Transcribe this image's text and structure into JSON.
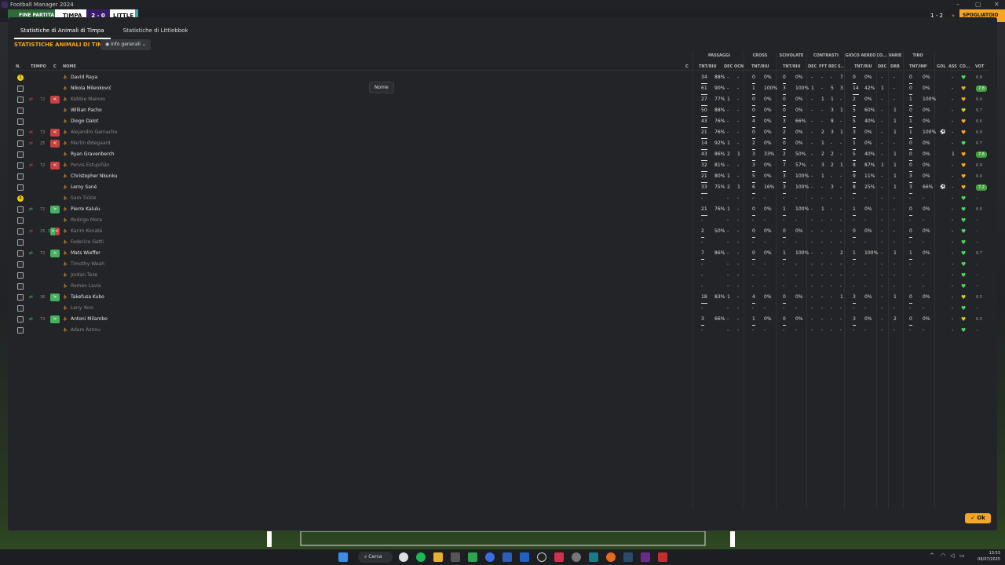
{
  "window": {
    "title": "Football Manager 2024",
    "minimize": "–",
    "maximize": "▢",
    "close": "✕"
  },
  "scorebar": {
    "end_label": "FINE PARTITA",
    "home": "TIMPA",
    "score": "2 - 0",
    "away": "LITTLE",
    "right_score": "1 - 2",
    "right_arrow": "»",
    "right_label": "SPOGLIATOIO"
  },
  "tabs": [
    {
      "label": "Statistiche di Animali di Timpa"
    },
    {
      "label": "Statistiche di Littlebbok"
    }
  ],
  "section_title": "STATISTICHE ANIMALI DI TIMPA",
  "view_dropdown": {
    "label": "Info generali"
  },
  "group_headers": {
    "passaggi": "PASSAGGI",
    "cross": "CROSS",
    "scivolate": "SCIVOLATE",
    "contrasti": "CONTRASTI",
    "gioco_aereo": "GIOCO AEREO",
    "co": "CO...",
    "varie": "VARIE",
    "tiro": "TIRO"
  },
  "col_headers": {
    "n": "N.",
    "tempo": "TEMPO",
    "c": "C",
    "nome": "NOME",
    "c2": "C",
    "pass": "TNT/RIU",
    "pass_dec": "DEC",
    "pass_occ": "OCN",
    "cross": "TNT/RIU",
    "sciv": "TNT/RIU",
    "con_dec": "DEC",
    "con_fft": "FFT",
    "con_rec": "REC",
    "con_s": "S...",
    "aereo": "TNT/RIU",
    "co_dec": "DEC",
    "drb": "DRB",
    "tiro": "TNT/INP",
    "gol": "GOL",
    "ass": "ASS",
    "cond": "CO...",
    "vot": "VOT"
  },
  "tooltip": "Nome",
  "players": [
    {
      "shirt": "gk",
      "no": "1",
      "sub": "",
      "min": "",
      "c": "",
      "name": "David Raya",
      "dim": false,
      "p1": "34",
      "p2": "88%",
      "pd": "-",
      "po": "-",
      "c1": "0",
      "c2": "0%",
      "s1": "0",
      "s2": "0%",
      "k1": "-",
      "k2": "-",
      "k3": "-",
      "k4": "7",
      "a1": "0",
      "a2": "0%",
      "cd": "-",
      "drb": "-",
      "t1": "0",
      "t2": "0%",
      "gol": "",
      "ass": "-",
      "heart": "g",
      "vot": "6.8"
    },
    {
      "shirt": "",
      "no": "",
      "sub": "",
      "min": "",
      "c": "",
      "name": "Nikola Milenković",
      "dim": false,
      "p1": "61",
      "p2": "90%",
      "pd": "-",
      "po": "-",
      "c1": "1",
      "c2": "100%",
      "s1": "3",
      "s2": "100%",
      "k1": "1",
      "k2": "-",
      "k3": "5",
      "k4": "3",
      "a1": "14",
      "a2": "42%",
      "cd": "1",
      "drb": "-",
      "t1": "0",
      "t2": "0%",
      "gol": "",
      "ass": "-",
      "heart": "o",
      "vot": "7.8",
      "hi": true
    },
    {
      "shirt": "",
      "no": "",
      "sub": "out",
      "min": "72",
      "c": "out",
      "name": "Kobbie Mainoo",
      "dim": true,
      "p1": "27",
      "p2": "77%",
      "pd": "1",
      "po": "-",
      "c1": "0",
      "c2": "0%",
      "s1": "0",
      "s2": "0%",
      "k1": "-",
      "k2": "1",
      "k3": "1",
      "k4": "-",
      "a1": "2",
      "a2": "0%",
      "cd": "-",
      "drb": "-",
      "t1": "1",
      "t2": "100%",
      "gol": "",
      "ass": "-",
      "heart": "o",
      "vot": "6.4"
    },
    {
      "shirt": "",
      "no": "",
      "sub": "",
      "min": "",
      "c": "",
      "name": "Willian Pacho",
      "dim": false,
      "p1": "50",
      "p2": "88%",
      "pd": "-",
      "po": "-",
      "c1": "0",
      "c2": "0%",
      "s1": "0",
      "s2": "0%",
      "k1": "-",
      "k2": "-",
      "k3": "3",
      "k4": "1",
      "a1": "5",
      "a2": "60%",
      "cd": "-",
      "drb": "1",
      "t1": "0",
      "t2": "0%",
      "gol": "",
      "ass": "-",
      "heart": "y",
      "vot": "6.7"
    },
    {
      "shirt": "",
      "no": "",
      "sub": "",
      "min": "",
      "c": "",
      "name": "Diogo Dalot",
      "dim": false,
      "p1": "43",
      "p2": "76%",
      "pd": "-",
      "po": "-",
      "c1": "4",
      "c2": "0%",
      "s1": "3",
      "s2": "66%",
      "k1": "-",
      "k2": "-",
      "k3": "8",
      "k4": "-",
      "a1": "5",
      "a2": "40%",
      "cd": "-",
      "drb": "1",
      "t1": "1",
      "t2": "0%",
      "gol": "",
      "ass": "-",
      "heart": "o",
      "vot": "6.6"
    },
    {
      "shirt": "",
      "no": "",
      "sub": "out",
      "min": "73",
      "c": "out",
      "name": "Alejandro Garnacho",
      "dim": true,
      "p1": "21",
      "p2": "76%",
      "pd": "-",
      "po": "-",
      "c1": "0",
      "c2": "0%",
      "s1": "2",
      "s2": "0%",
      "k1": "-",
      "k2": "2",
      "k3": "3",
      "k4": "1",
      "a1": "3",
      "a2": "0%",
      "cd": "-",
      "drb": "1",
      "t1": "1",
      "t2": "100%",
      "gol": "⚽",
      "ass": "-",
      "heart": "o",
      "vot": "6.9"
    },
    {
      "shirt": "",
      "no": "",
      "sub": "out",
      "min": "25",
      "c": "out",
      "name": "Martin Ødegaard",
      "dim": true,
      "p1": "14",
      "p2": "92%",
      "pd": "1",
      "po": "-",
      "c1": "2",
      "c2": "0%",
      "s1": "0",
      "s2": "0%",
      "k1": "-",
      "k2": "1",
      "k3": "-",
      "k4": "-",
      "a1": "1",
      "a2": "0%",
      "cd": "-",
      "drb": "-",
      "t1": "0",
      "t2": "0%",
      "gol": "",
      "ass": "-",
      "heart": "g",
      "vot": "6.7"
    },
    {
      "shirt": "",
      "no": "",
      "sub": "",
      "min": "",
      "c": "",
      "name": "Ryan Gravenberch",
      "dim": false,
      "p1": "43",
      "p2": "86%",
      "pd": "2",
      "po": "1",
      "c1": "3",
      "c2": "33%",
      "s1": "2",
      "s2": "50%",
      "k1": "-",
      "k2": "2",
      "k3": "2",
      "k4": "-",
      "a1": "5",
      "a2": "40%",
      "cd": "-",
      "drb": "1",
      "t1": "0",
      "t2": "0%",
      "gol": "",
      "ass": "1",
      "heart": "o",
      "vot": "7.6",
      "hi": true
    },
    {
      "shirt": "",
      "no": "",
      "sub": "out",
      "min": "72",
      "c": "out",
      "name": "Pervis Estupiñán",
      "dim": true,
      "p1": "32",
      "p2": "81%",
      "pd": "-",
      "po": "-",
      "c1": "3",
      "c2": "0%",
      "s1": "7",
      "s2": "57%",
      "k1": "-",
      "k2": "3",
      "k3": "2",
      "k4": "1",
      "a1": "8",
      "a2": "87%",
      "cd": "1",
      "drb": "1",
      "t1": "0",
      "t2": "0%",
      "gol": "",
      "ass": "-",
      "heart": "o",
      "vot": "6.9"
    },
    {
      "shirt": "",
      "no": "",
      "sub": "",
      "min": "",
      "c": "",
      "name": "Christopher Nkunku",
      "dim": false,
      "p1": "21",
      "p2": "80%",
      "pd": "1",
      "po": "-",
      "c1": "5",
      "c2": "0%",
      "s1": "3",
      "s2": "100%",
      "k1": "-",
      "k2": "1",
      "k3": "-",
      "k4": "-",
      "a1": "9",
      "a2": "11%",
      "cd": "-",
      "drb": "1",
      "t1": "3",
      "t2": "0%",
      "gol": "",
      "ass": "-",
      "heart": "o",
      "vot": "6.4"
    },
    {
      "shirt": "",
      "no": "",
      "sub": "",
      "min": "",
      "c": "",
      "name": "Leroy Sané",
      "dim": false,
      "p1": "33",
      "p2": "75%",
      "pd": "2",
      "po": "1",
      "c1": "6",
      "c2": "16%",
      "s1": "3",
      "s2": "100%",
      "k1": "-",
      "k2": "-",
      "k3": "3",
      "k4": "-",
      "a1": "8",
      "a2": "25%",
      "cd": "-",
      "drb": "1",
      "t1": "3",
      "t2": "66%",
      "gol": "⚽",
      "ass": "-",
      "heart": "o",
      "vot": "7.2",
      "hi": true
    },
    {
      "shirt": "gk",
      "no": "R",
      "sub": "",
      "min": "",
      "c": "",
      "name": "Sam Tickle",
      "dim": true,
      "p1": "-",
      "p2": "",
      "pd": "-",
      "po": "-",
      "c1": "-",
      "c2": "-",
      "s1": "-",
      "s2": "-",
      "k1": "-",
      "k2": "-",
      "k3": "-",
      "k4": "-",
      "a1": "-",
      "a2": "-",
      "cd": "-",
      "drb": "-",
      "t1": "-",
      "t2": "-",
      "gol": "",
      "ass": "-",
      "heart": "g",
      "vot": "-"
    },
    {
      "shirt": "",
      "no": "",
      "sub": "in",
      "min": "72",
      "c": "in",
      "name": "Pierre Kalulu",
      "dim": false,
      "p1": "21",
      "p2": "76%",
      "pd": "1",
      "po": "-",
      "c1": "0",
      "c2": "0%",
      "s1": "1",
      "s2": "100%",
      "k1": "-",
      "k2": "1",
      "k3": "-",
      "k4": "-",
      "a1": "1",
      "a2": "0%",
      "cd": "-",
      "drb": "-",
      "t1": "0",
      "t2": "0%",
      "gol": "",
      "ass": "-",
      "heart": "g",
      "vot": "6.6"
    },
    {
      "shirt": "",
      "no": "",
      "sub": "",
      "min": "",
      "c": "",
      "name": "Rodrigo Mora",
      "dim": true,
      "p1": "-",
      "p2": "",
      "pd": "-",
      "po": "-",
      "c1": "-",
      "c2": "-",
      "s1": "-",
      "s2": "-",
      "k1": "-",
      "k2": "-",
      "k3": "-",
      "k4": "-",
      "a1": "-",
      "a2": "-",
      "cd": "-",
      "drb": "-",
      "t1": "-",
      "t2": "-",
      "gol": "",
      "ass": "-",
      "heart": "g",
      "vot": "-"
    },
    {
      "shirt": "",
      "no": "",
      "sub": "both",
      "min": "25, 36",
      "c": "both",
      "name": "Karim Konaté",
      "dim": true,
      "p1": "2",
      "p2": "50%",
      "pd": "-",
      "po": "-",
      "c1": "0",
      "c2": "0%",
      "s1": "0",
      "s2": "0%",
      "k1": "-",
      "k2": "-",
      "k3": "-",
      "k4": "-",
      "a1": "0",
      "a2": "0%",
      "cd": "-",
      "drb": "-",
      "t1": "0",
      "t2": "0%",
      "gol": "",
      "ass": "-",
      "heart": "g",
      "vot": "-"
    },
    {
      "shirt": "",
      "no": "",
      "sub": "",
      "min": "",
      "c": "",
      "name": "Federico Gatti",
      "dim": true,
      "p1": "-",
      "p2": "",
      "pd": "-",
      "po": "-",
      "c1": "-",
      "c2": "-",
      "s1": "-",
      "s2": "-",
      "k1": "-",
      "k2": "-",
      "k3": "-",
      "k4": "-",
      "a1": "-",
      "a2": "-",
      "cd": "-",
      "drb": "-",
      "t1": "-",
      "t2": "-",
      "gol": "",
      "ass": "-",
      "heart": "g",
      "vot": "-"
    },
    {
      "shirt": "",
      "no": "",
      "sub": "in",
      "min": "72",
      "c": "in",
      "name": "Mats Wieffer",
      "dim": false,
      "p1": "7",
      "p2": "86%",
      "pd": "-",
      "po": "-",
      "c1": "0",
      "c2": "0%",
      "s1": "1",
      "s2": "100%",
      "k1": "-",
      "k2": "-",
      "k3": "-",
      "k4": "2",
      "a1": "1",
      "a2": "100%",
      "cd": "-",
      "drb": "1",
      "t1": "1",
      "t2": "0%",
      "gol": "",
      "ass": "-",
      "heart": "g",
      "vot": "6.7"
    },
    {
      "shirt": "",
      "no": "",
      "sub": "",
      "min": "",
      "c": "",
      "name": "Timothy Weah",
      "dim": true,
      "p1": "-",
      "p2": "",
      "pd": "-",
      "po": "-",
      "c1": "-",
      "c2": "-",
      "s1": "-",
      "s2": "-",
      "k1": "-",
      "k2": "-",
      "k3": "-",
      "k4": "-",
      "a1": "-",
      "a2": "-",
      "cd": "-",
      "drb": "-",
      "t1": "-",
      "t2": "-",
      "gol": "",
      "ass": "-",
      "heart": "g",
      "vot": "-"
    },
    {
      "shirt": "",
      "no": "",
      "sub": "",
      "min": "",
      "c": "",
      "name": "Jordan Teze",
      "dim": true,
      "p1": "-",
      "p2": "",
      "pd": "-",
      "po": "-",
      "c1": "-",
      "c2": "-",
      "s1": "-",
      "s2": "-",
      "k1": "-",
      "k2": "-",
      "k3": "-",
      "k4": "-",
      "a1": "-",
      "a2": "-",
      "cd": "-",
      "drb": "-",
      "t1": "-",
      "t2": "-",
      "gol": "",
      "ass": "-",
      "heart": "g",
      "vot": "-"
    },
    {
      "shirt": "",
      "no": "",
      "sub": "",
      "min": "",
      "c": "",
      "name": "Roméo Lavia",
      "dim": true,
      "p1": "-",
      "p2": "",
      "pd": "-",
      "po": "-",
      "c1": "-",
      "c2": "-",
      "s1": "-",
      "s2": "-",
      "k1": "-",
      "k2": "-",
      "k3": "-",
      "k4": "-",
      "a1": "-",
      "a2": "-",
      "cd": "-",
      "drb": "-",
      "t1": "-",
      "t2": "-",
      "gol": "",
      "ass": "-",
      "heart": "g",
      "vot": "-"
    },
    {
      "shirt": "",
      "no": "",
      "sub": "in",
      "min": "36",
      "c": "in",
      "name": "Takefusa Kubo",
      "dim": false,
      "p1": "18",
      "p2": "83%",
      "pd": "1",
      "po": "-",
      "c1": "4",
      "c2": "0%",
      "s1": "0",
      "s2": "0%",
      "k1": "-",
      "k2": "-",
      "k3": "-",
      "k4": "1",
      "a1": "3",
      "a2": "0%",
      "cd": "-",
      "drb": "1",
      "t1": "0",
      "t2": "0%",
      "gol": "",
      "ass": "-",
      "heart": "y",
      "vot": "6.5"
    },
    {
      "shirt": "",
      "no": "",
      "sub": "",
      "min": "",
      "c": "",
      "name": "Leny Yoro",
      "dim": true,
      "p1": "-",
      "p2": "",
      "pd": "-",
      "po": "-",
      "c1": "-",
      "c2": "-",
      "s1": "-",
      "s2": "-",
      "k1": "-",
      "k2": "-",
      "k3": "-",
      "k4": "-",
      "a1": "-",
      "a2": "-",
      "cd": "-",
      "drb": "-",
      "t1": "-",
      "t2": "-",
      "gol": "",
      "ass": "-",
      "heart": "g",
      "vot": "-"
    },
    {
      "shirt": "",
      "no": "",
      "sub": "in",
      "min": "73",
      "c": "in",
      "name": "Antoni Milambo",
      "dim": false,
      "p1": "3",
      "p2": "66%",
      "pd": "-",
      "po": "-",
      "c1": "1",
      "c2": "0%",
      "s1": "0",
      "s2": "0%",
      "k1": "-",
      "k2": "-",
      "k3": "-",
      "k4": "-",
      "a1": "3",
      "a2": "0%",
      "cd": "-",
      "drb": "2",
      "t1": "0",
      "t2": "0%",
      "gol": "",
      "ass": "-",
      "heart": "y",
      "vot": "6.5"
    },
    {
      "shirt": "",
      "no": "",
      "sub": "",
      "min": "",
      "c": "",
      "name": "Adam Aznou",
      "dim": true,
      "p1": "-",
      "p2": "",
      "pd": "-",
      "po": "-",
      "c1": "-",
      "c2": "-",
      "s1": "-",
      "s2": "-",
      "k1": "-",
      "k2": "-",
      "k3": "-",
      "k4": "-",
      "a1": "-",
      "a2": "-",
      "cd": "-",
      "drb": "-",
      "t1": "-",
      "t2": "-",
      "gol": "",
      "ass": "-",
      "heart": "g",
      "vot": "-"
    }
  ],
  "ok_button": "✓ Ok",
  "taskbar": {
    "search": "Cerca",
    "time": "13:53",
    "date": "06/07/2025"
  },
  "colors": {
    "accent": "#f5a623",
    "sub_out": "#c84040",
    "sub_in": "#44b060",
    "panel": "#222427"
  }
}
